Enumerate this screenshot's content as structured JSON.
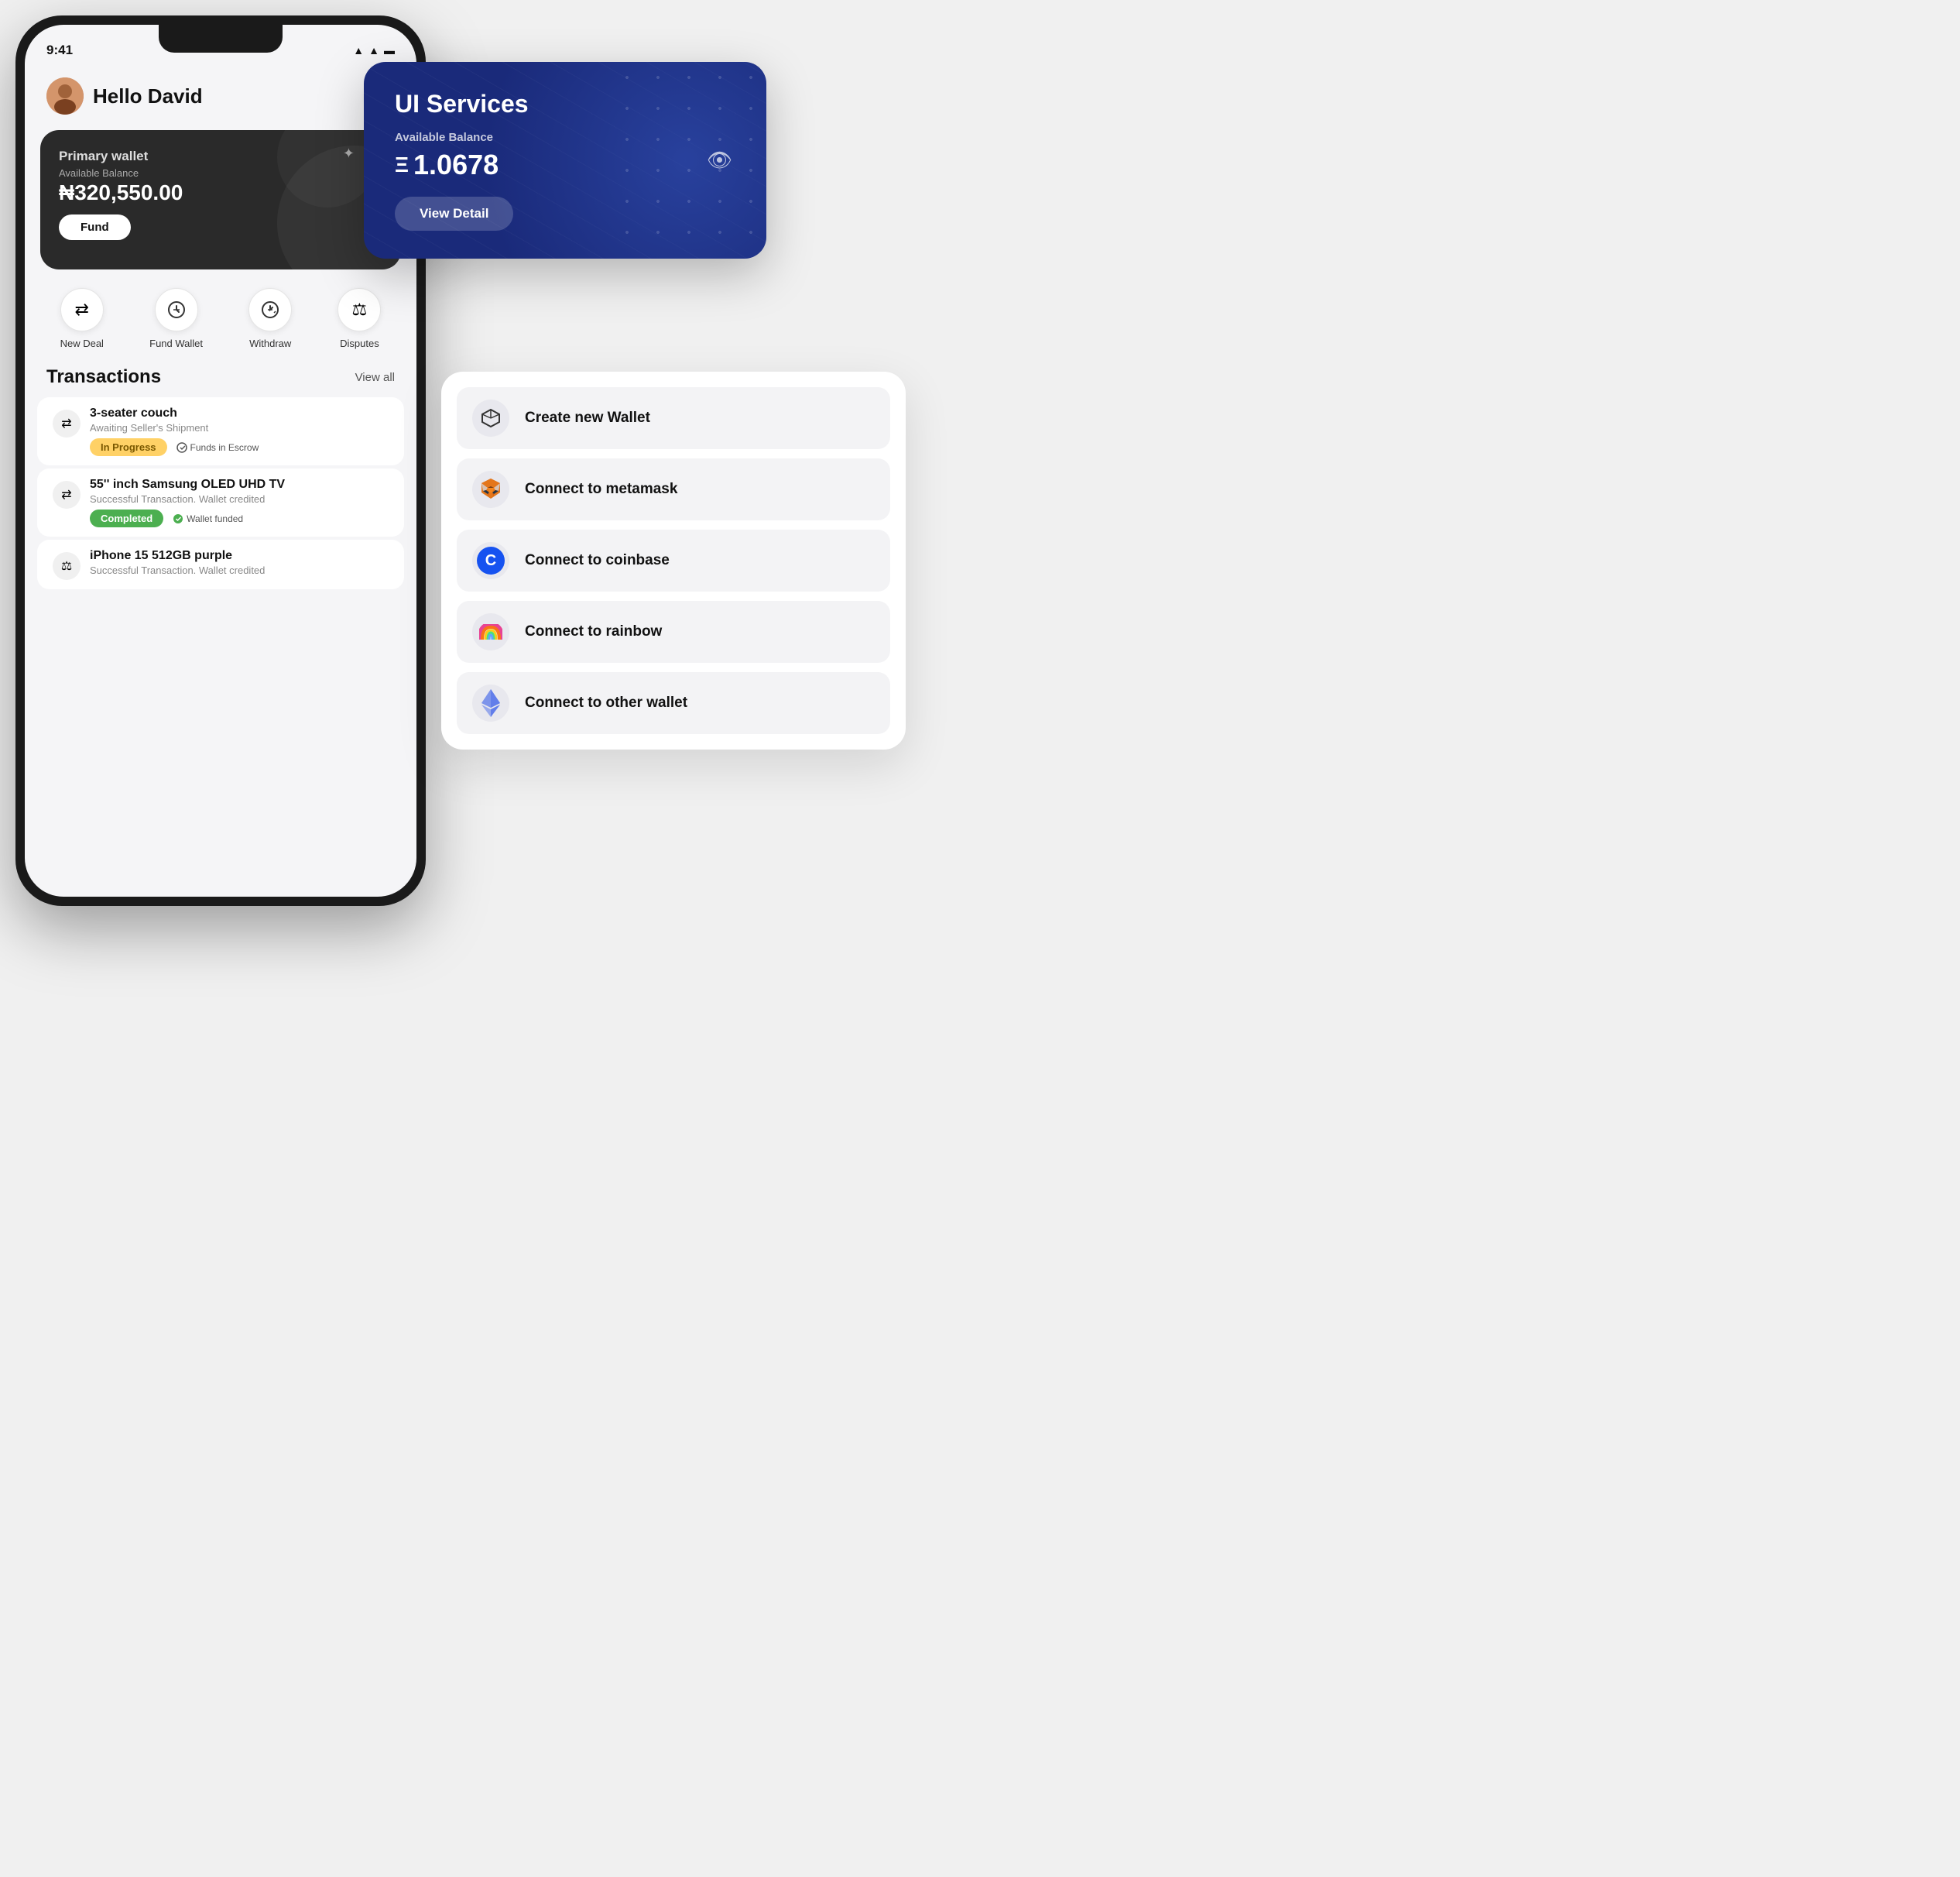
{
  "statusBar": {
    "time": "9:41",
    "icons": "▲ ▲ ▬"
  },
  "header": {
    "greeting": "Hello David",
    "avatarEmoji": "👤"
  },
  "primaryWallet": {
    "title": "Primary wallet",
    "balanceLabel": "Available Balance",
    "amount": "₦320,550.00",
    "fundButton": "Fund"
  },
  "quickActions": [
    {
      "icon": "⇄",
      "label": "New Deal"
    },
    {
      "icon": "↺₦",
      "label": "Fund Wallet"
    },
    {
      "icon": "↺↗",
      "label": "Withdraw"
    },
    {
      "icon": "⚖",
      "label": "Disputes"
    }
  ],
  "transactions": {
    "title": "Transactions",
    "viewAll": "View all",
    "items": [
      {
        "name": "3-seater couch",
        "sub": "Awaiting Seller's Shipment",
        "badge": "In Progress",
        "badgeType": "progress",
        "escrow": "Funds in Escrow"
      },
      {
        "name": "55'' inch Samsung OLED UHD TV",
        "sub": "Successful Transaction. Wallet credited",
        "badge": "Completed",
        "badgeType": "completed",
        "escrow": "Wallet funded"
      },
      {
        "name": "iPhone 15 512GB purple",
        "sub": "Successful Transaction. Wallet credited",
        "badge": "",
        "badgeType": "",
        "escrow": ""
      }
    ]
  },
  "blueCard": {
    "title": "UI Services",
    "balanceLabel": "Available Balance",
    "amount": "1.0678",
    "ethSymbol": "Ξ",
    "viewDetailButton": "View Detail"
  },
  "walletMenu": {
    "items": [
      {
        "id": "create",
        "label": "Create new Wallet",
        "iconType": "cube"
      },
      {
        "id": "metamask",
        "label": "Connect to metamask",
        "iconType": "fox"
      },
      {
        "id": "coinbase",
        "label": "Connect to coinbase",
        "iconType": "coinbase"
      },
      {
        "id": "rainbow",
        "label": "Connect to rainbow",
        "iconType": "rainbow"
      },
      {
        "id": "other",
        "label": "Connect to other wallet",
        "iconType": "eth"
      }
    ]
  }
}
